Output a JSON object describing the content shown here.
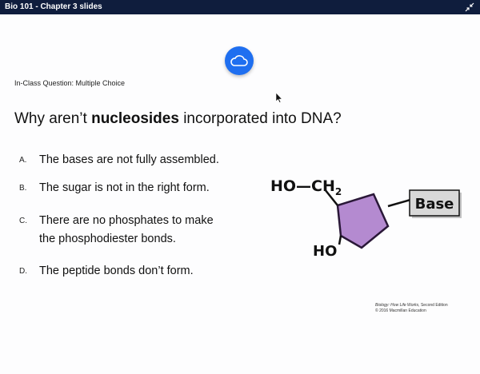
{
  "window": {
    "title": "Bio 101 - Chapter 3 slides"
  },
  "slide": {
    "question_type": "In-Class Question: Multiple Choice",
    "question_prefix": "Why aren’t ",
    "question_bold": "nucleosides",
    "question_suffix": " incorporated into DNA?",
    "options": [
      {
        "letter": "A.",
        "text": "The bases are not fully assembled."
      },
      {
        "letter": "B.",
        "text": "The sugar is not in the right form."
      },
      {
        "letter": "C.",
        "text_line1": "There are no phosphates to make",
        "text_line2": "the phosphodiester bonds."
      },
      {
        "letter": "D.",
        "text": "The peptide bonds don’t form."
      }
    ],
    "diagram": {
      "label_top": "HO—CH",
      "label_top_sub": "2",
      "label_bottom": "HO",
      "base_label": "Base",
      "sugar_color": "#b48ad0",
      "base_box_color": "#d8d8d8"
    },
    "credit": {
      "book_title": "Biology: How Life Works,",
      "edition": " Second Edition",
      "copyright": "© 2016 Macmillan Education"
    }
  },
  "icons": {
    "cloud_button": "cloud-icon",
    "expand": "collapse-arrows-icon",
    "cursor": "mouse-pointer-icon"
  },
  "colors": {
    "titlebar": "#0f1d3d",
    "cloud_button": "#1f6ff0"
  }
}
